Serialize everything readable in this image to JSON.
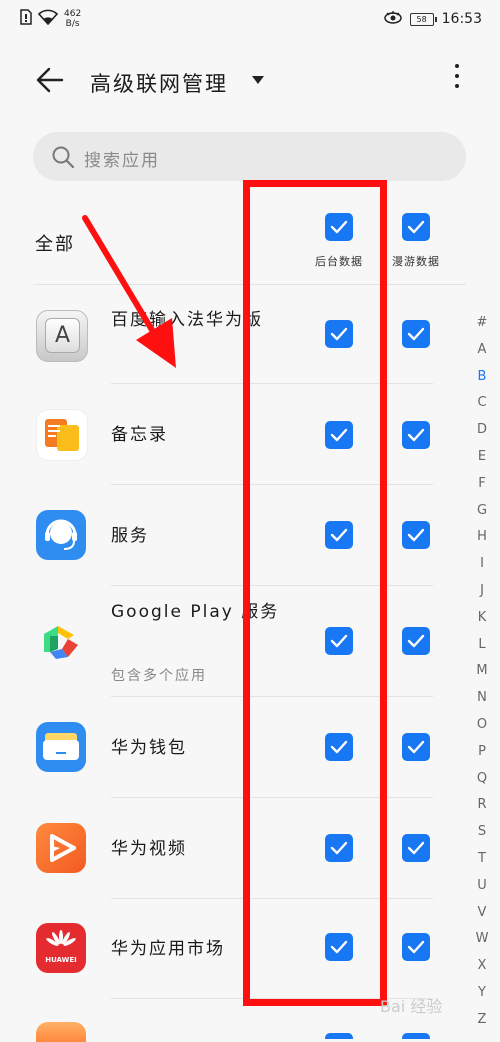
{
  "status_bar": {
    "net_speed": "462",
    "net_unit": "B/s",
    "battery": "58",
    "time": "16:53"
  },
  "header": {
    "title": "高级联网管理",
    "back_icon": "arrow-left-icon",
    "more_icon": "more-vertical-icon"
  },
  "search": {
    "placeholder": "搜索应用",
    "icon": "search-icon"
  },
  "filter": {
    "all_label": "全部",
    "col_background": "后台数据",
    "col_roaming": "漫游数据",
    "all_background_checked": true,
    "all_roaming_checked": true
  },
  "apps": [
    {
      "name": "百度输入法华为版",
      "sub": "",
      "icon": "baidu-input-icon",
      "background": true,
      "roaming": true
    },
    {
      "name": "备忘录",
      "sub": "",
      "icon": "notes-icon",
      "background": true,
      "roaming": true
    },
    {
      "name": "服务",
      "sub": "",
      "icon": "service-icon",
      "background": true,
      "roaming": true
    },
    {
      "name": "Google Play 服务",
      "sub": "包含多个应用",
      "icon": "google-play-services-icon",
      "background": true,
      "roaming": true
    },
    {
      "name": "华为钱包",
      "sub": "",
      "icon": "wallet-icon",
      "background": true,
      "roaming": true
    },
    {
      "name": "华为视频",
      "sub": "",
      "icon": "video-icon",
      "background": true,
      "roaming": true
    },
    {
      "name": "华为应用市场",
      "sub": "",
      "icon": "app-market-icon",
      "background": true,
      "roaming": true
    }
  ],
  "index_letters": [
    "#",
    "A",
    "B",
    "C",
    "D",
    "E",
    "F",
    "G",
    "H",
    "I",
    "J",
    "K",
    "L",
    "M",
    "N",
    "O",
    "P",
    "Q",
    "R",
    "S",
    "T",
    "U",
    "V",
    "W",
    "X",
    "Y",
    "Z"
  ],
  "index_active": "B",
  "huawei_label": "HUAWEI",
  "watermark": "Bai 经验",
  "colors": {
    "accent": "#1877f2",
    "annotation": "#ff1010"
  }
}
